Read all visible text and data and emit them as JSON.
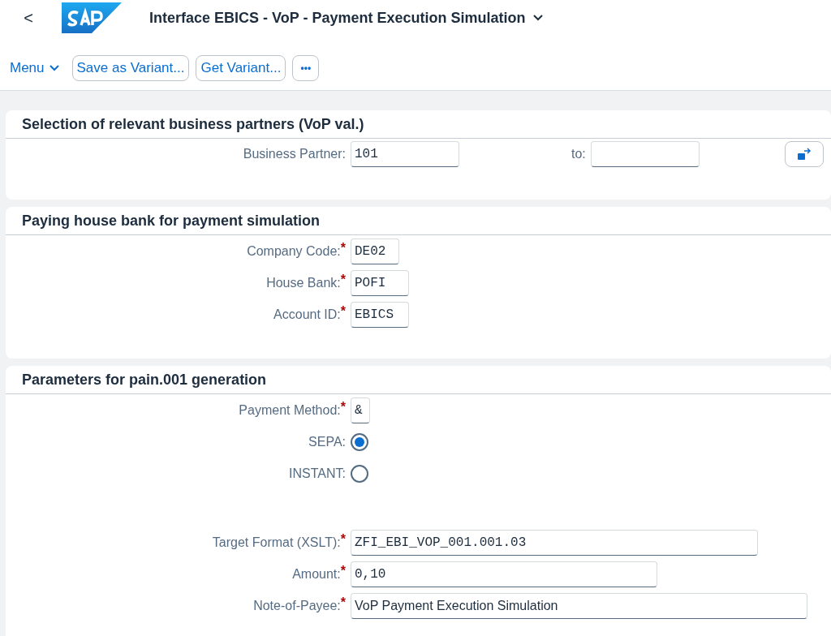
{
  "header": {
    "back": "<",
    "title": "Interface EBICS - VoP - Payment Execution Simulation"
  },
  "toolbar": {
    "menu": "Menu",
    "buttons": [
      "Save as Variant...",
      "Get Variant..."
    ],
    "more": "•••"
  },
  "selection": {
    "title": "Selection of relevant business partners (VoP val.)",
    "label": "Business Partner:",
    "value": "101",
    "to_label": "to:"
  },
  "house_bank": {
    "title": "Paying house bank for payment simulation",
    "fields": [
      {
        "kind": "input",
        "label": "Company Code:",
        "required_marker": "*",
        "value": "DE02"
      },
      {
        "kind": "input",
        "label": "House Bank:",
        "required_marker": "*",
        "value": "POFI"
      },
      {
        "kind": "input",
        "label": "Account ID:",
        "required_marker": "*",
        "value": "EBICS"
      }
    ]
  },
  "parameters": {
    "title": "Parameters for pain.001 generation",
    "fields": [
      {
        "kind": "input",
        "label": "Payment Method:",
        "required_marker": "*",
        "value": "&"
      },
      {
        "kind": "radio",
        "label": "SEPA:",
        "selected": true
      },
      {
        "kind": "radio",
        "label": "INSTANT:",
        "selected": false
      },
      {
        "kind": "spacer"
      },
      {
        "kind": "input",
        "label": "Target Format (XSLT):",
        "required_marker": "*",
        "value": "ZFI_EBI_VOP_001.001.03"
      },
      {
        "kind": "input",
        "label": "Amount:",
        "required_marker": "*",
        "value": "0,10"
      },
      {
        "kind": "text",
        "label": "Note-of-Payee:",
        "required_marker": "*",
        "value": "VoP Payment Execution Simulation"
      }
    ]
  }
}
